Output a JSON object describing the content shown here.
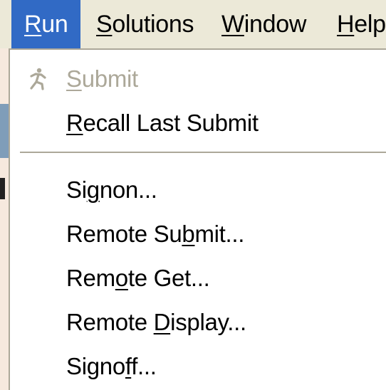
{
  "menubar": {
    "items": [
      {
        "pre": "",
        "key": "R",
        "post": "un"
      },
      {
        "pre": "",
        "key": "S",
        "post": "olutions"
      },
      {
        "pre": "",
        "key": "W",
        "post": "indow"
      },
      {
        "pre": "",
        "key": "H",
        "post": "elp"
      }
    ],
    "active_index": 0
  },
  "run_menu": {
    "items": [
      {
        "pre": "",
        "key": "S",
        "post": "ubmit",
        "disabled": true,
        "icon": "running-person-icon"
      },
      {
        "pre": "",
        "key": "R",
        "post": "ecall Last Submit",
        "disabled": false
      },
      {
        "separator": true
      },
      {
        "pre": "Si",
        "key": "g",
        "post": "non...",
        "disabled": false
      },
      {
        "pre": "Remote Su",
        "key": "b",
        "post": "mit...",
        "disabled": false
      },
      {
        "pre": "Rem",
        "key": "o",
        "post": "te Get...",
        "disabled": false
      },
      {
        "pre": "Remote ",
        "key": "D",
        "post": "isplay...",
        "disabled": false
      },
      {
        "pre": "Signo",
        "key": "f",
        "post": "f...",
        "disabled": false
      }
    ]
  },
  "colors": {
    "menu_highlight": "#316ac5",
    "menubar_bg": "#ece9d8",
    "disabled_text": "#aca899",
    "menu_bg": "#ffffff"
  }
}
